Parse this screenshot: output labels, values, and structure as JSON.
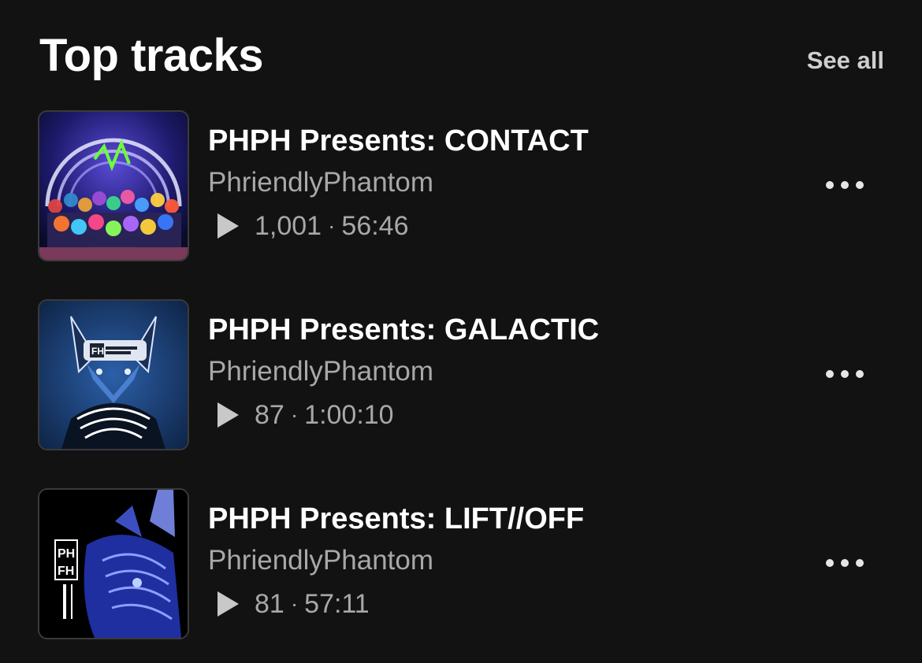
{
  "header": {
    "title": "Top tracks",
    "see_all": "See all"
  },
  "tracks": [
    {
      "title": "PHPH Presents: CONTACT",
      "artist": "PhriendlyPhantom",
      "plays": "1,001",
      "separator": "·",
      "duration": "56:46",
      "artwork": "crowd-stage-artwork"
    },
    {
      "title": "PHPH Presents: GALACTIC",
      "artist": "PhriendlyPhantom",
      "plays": "87",
      "separator": "·",
      "duration": "1:00:10",
      "artwork": "blue-fox-cap-artwork",
      "artwork_text": "FH"
    },
    {
      "title": "PHPH Presents: LIFT//OFF",
      "artist": "PhriendlyPhantom",
      "plays": "81",
      "separator": "·",
      "duration": "57:11",
      "artwork": "fox-logo-artwork",
      "artwork_text_top": "PH",
      "artwork_text_bottom": "FH"
    }
  ],
  "icons": {
    "play": "play-icon",
    "more": "more-options-icon"
  },
  "colors": {
    "background": "#121212",
    "primary_text": "#ffffff",
    "secondary_text": "#a8a8a8"
  }
}
